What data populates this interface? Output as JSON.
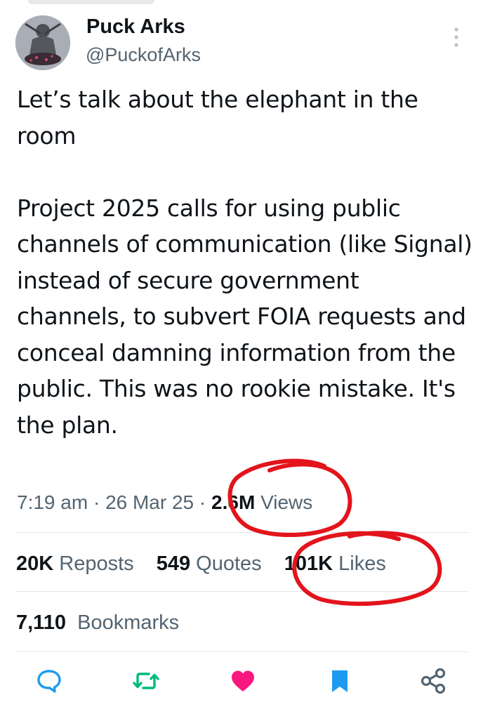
{
  "author": {
    "name": "Puck Arks",
    "handle": "@PuckofArks"
  },
  "tweet": {
    "text": "Let’s talk about the elephant in the room\n\nProject 2025 calls for using public channels of communication (like Signal) instead of secure government channels, to subvert FOIA requests and conceal damning information from the public. This was no rookie mistake. It's the plan.",
    "time": "7:19 am",
    "separator": "·",
    "date": "26 Mar 25",
    "views_count": "2.6M",
    "views_label": "Views"
  },
  "stats": {
    "reposts_count": "20K",
    "reposts_label": "Reposts",
    "quotes_count": "549",
    "quotes_label": "Quotes",
    "likes_count": "101K",
    "likes_label": "Likes",
    "bookmarks_count": "7,110",
    "bookmarks_label": "Bookmarks"
  },
  "actions": [
    {
      "name": "reply",
      "icon": "speech-bubble-icon",
      "color": "#1d9bf0"
    },
    {
      "name": "repost",
      "icon": "repost-arrows-icon",
      "color": "#00ba7c"
    },
    {
      "name": "like",
      "icon": "heart-icon",
      "color": "#f91880"
    },
    {
      "name": "bookmark",
      "icon": "bookmark-icon",
      "color": "#1d9bf0"
    },
    {
      "name": "share",
      "icon": "share-nodes-icon",
      "color": "#1d9bf0"
    }
  ],
  "colors": {
    "primary_text": "#0f1419",
    "secondary_text": "#536471",
    "annotation_red": "#e3141c"
  }
}
